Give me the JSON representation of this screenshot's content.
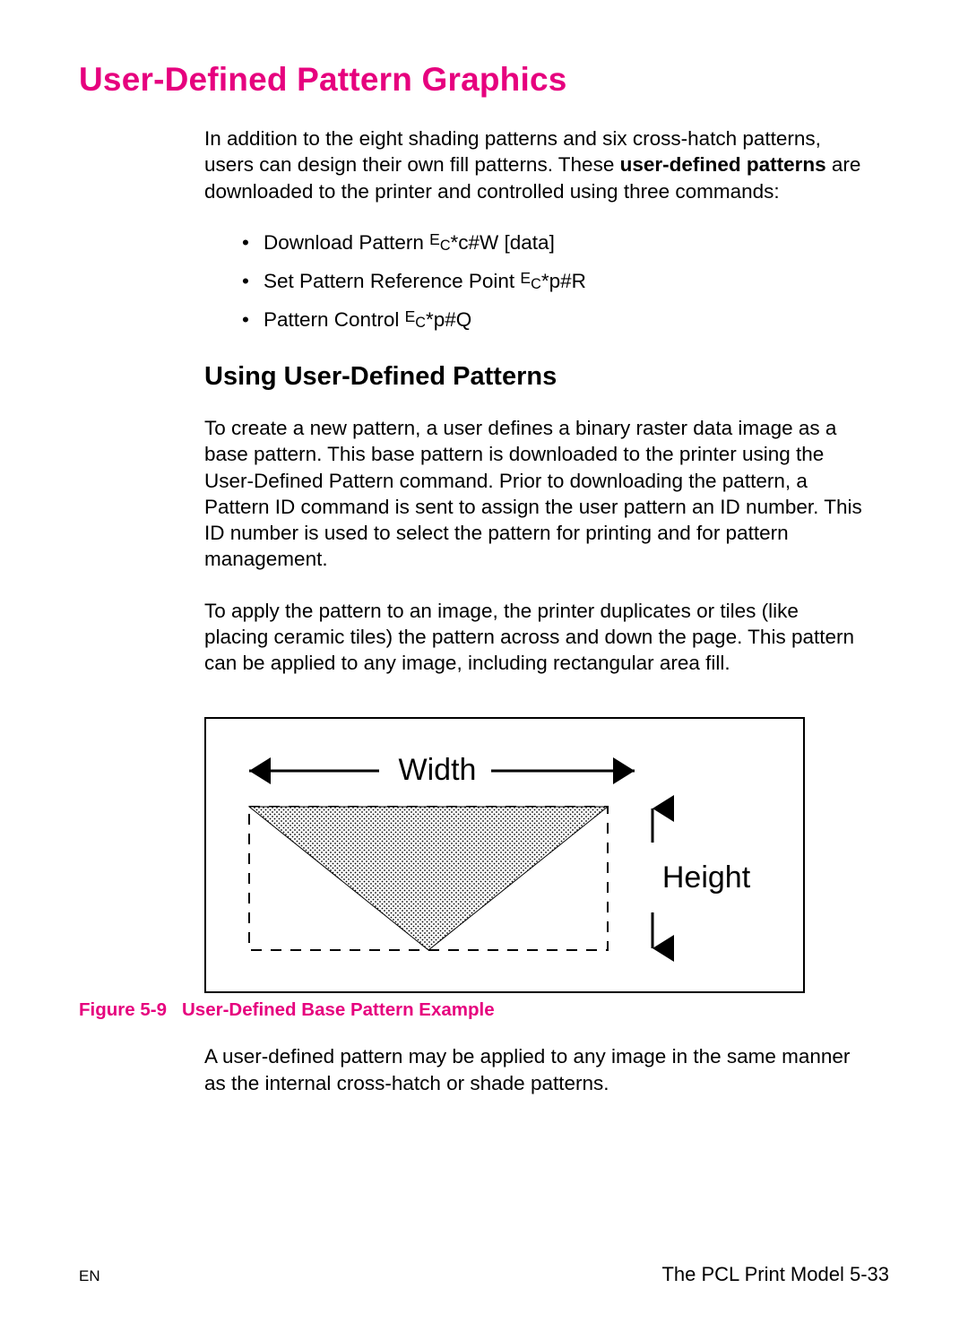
{
  "heading1": "User-Defined Pattern Graphics",
  "intro": {
    "part1": "In addition to the eight shading patterns and six cross-hatch patterns, users can design their own fill patterns. These ",
    "bold": "user-defined patterns",
    "part2": " are downloaded to the printer and controlled using three commands:"
  },
  "commands": [
    {
      "pre": "Download Pattern ",
      "escPrefix": "E",
      "escC": "C",
      "tail": "*c#W [data]"
    },
    {
      "pre": "Set Pattern Reference Point ",
      "escPrefix": "E",
      "escC": "C",
      "tail": "*p#R"
    },
    {
      "pre": "Pattern Control ",
      "escPrefix": "E",
      "escC": "C",
      "tail": "*p#Q"
    }
  ],
  "heading2": "Using User-Defined Patterns",
  "p1": "To create a new pattern, a user defines a binary raster data image as a base pattern. This base pattern is downloaded to the printer using the User-Defined Pattern command. Prior to downloading the pattern, a Pattern ID command is sent to assign the user pattern an ID number. This ID number is used to select the pattern for printing and for pattern management.",
  "p2": "To apply the pattern to an image, the printer duplicates or tiles (like placing ceramic tiles) the pattern across and down the page. This pattern can be applied to any image, including rectangular area fill.",
  "figure": {
    "label": "Figure 5-9",
    "title": "User-Defined Base Pattern Example",
    "widthLabel": "Width",
    "heightLabel": "Height"
  },
  "p3": "A user-defined pattern may be applied to any image in the same manner as the internal cross-hatch or shade patterns.",
  "footer": {
    "left": "EN",
    "right": "The PCL Print Model 5-33"
  },
  "colors": {
    "accent": "#e6007e"
  }
}
